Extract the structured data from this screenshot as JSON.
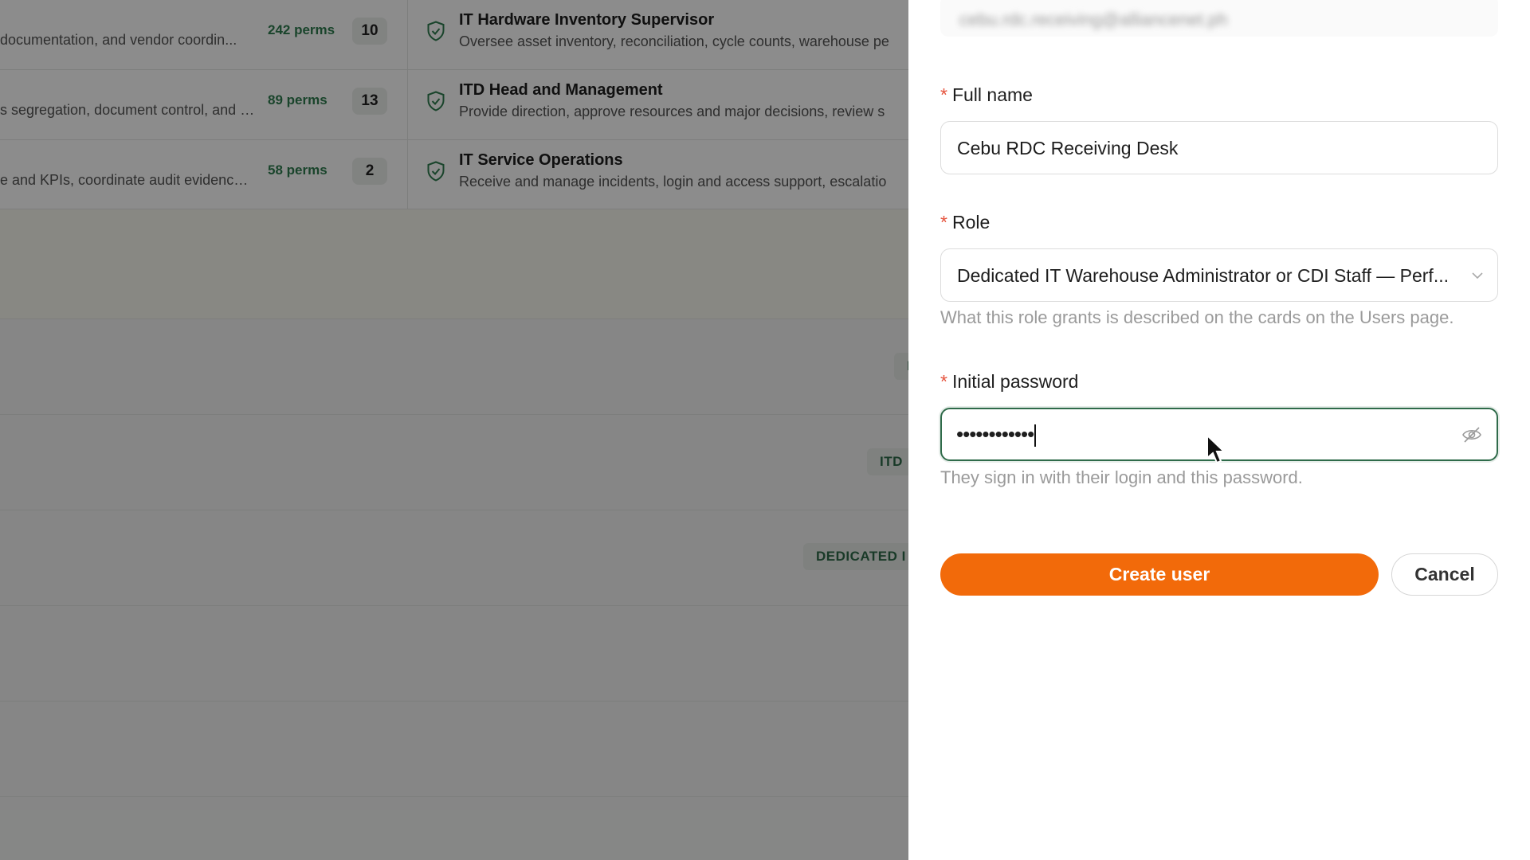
{
  "background": {
    "cards": [
      {
        "desc_left": "documentation, and vendor coordin...",
        "perms": "242 perms",
        "count": "10",
        "title": "IT Hardware Inventory Supervisor",
        "desc": "Oversee asset inventory, reconciliation, cycle counts, warehouse pe"
      },
      {
        "desc_left": "s segregation, document control, and r...",
        "perms": "89 perms",
        "count": "13",
        "title": "ITD Head and Management",
        "desc": "Provide direction, approve resources and major decisions, review s"
      },
      {
        "desc_left": "e and KPIs, coordinate audit evidence, ...",
        "perms": "58 perms",
        "count": "2",
        "title": "IT Service Operations",
        "desc": "Receive and manage incidents, login and access support, escalatio"
      }
    ],
    "tags": [
      "I",
      "ITD",
      "DEDICATED I"
    ]
  },
  "form": {
    "email_value": "cebu.rdc.receiving@alliancenet.ph",
    "fullname_label": "Full name",
    "fullname_value": "Cebu RDC Receiving Desk",
    "role_label": "Role",
    "role_value": "Dedicated IT Warehouse Administrator or CDI Staff — Perf...",
    "role_hint": "What this role grants is described on the cards on the Users page.",
    "password_label": "Initial password",
    "password_value": "••••••••••••",
    "password_hint": "They sign in with their login and this password.",
    "required_mark": "*",
    "create_label": "Create user",
    "cancel_label": "Cancel"
  },
  "colors": {
    "accent": "#f26a0a",
    "focus": "#2f6b4a",
    "perms": "#2f7d4f",
    "required": "#e5533d"
  },
  "icons": {
    "shield": "shield-check-icon",
    "chevron": "chevron-down-icon",
    "eye": "eye-off-icon",
    "cursor": "mouse-pointer-icon"
  }
}
